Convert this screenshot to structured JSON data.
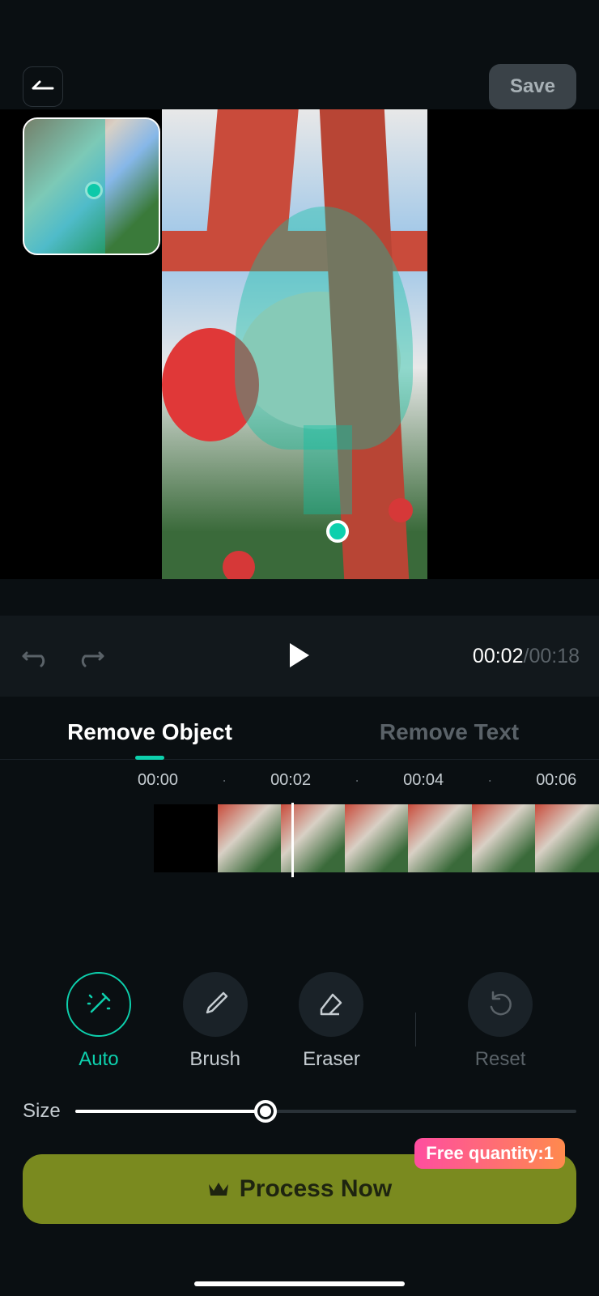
{
  "header": {
    "save_label": "Save"
  },
  "playback": {
    "current_time": "00:02",
    "duration": "00:18"
  },
  "tabs": {
    "remove_object": "Remove Object",
    "remove_text": "Remove Text",
    "active": "remove_object"
  },
  "timeline": {
    "marks": [
      "00:00",
      "·",
      "00:02",
      "·",
      "00:04",
      "·",
      "00:06"
    ]
  },
  "tools": {
    "auto": "Auto",
    "brush": "Brush",
    "eraser": "Eraser",
    "reset": "Reset",
    "active": "auto"
  },
  "size": {
    "label": "Size",
    "value_pct": 38
  },
  "process": {
    "label": "Process Now",
    "badge": "Free quantity:1"
  },
  "colors": {
    "accent": "#0dd0ad",
    "process_bg": "#7a8a1f"
  }
}
